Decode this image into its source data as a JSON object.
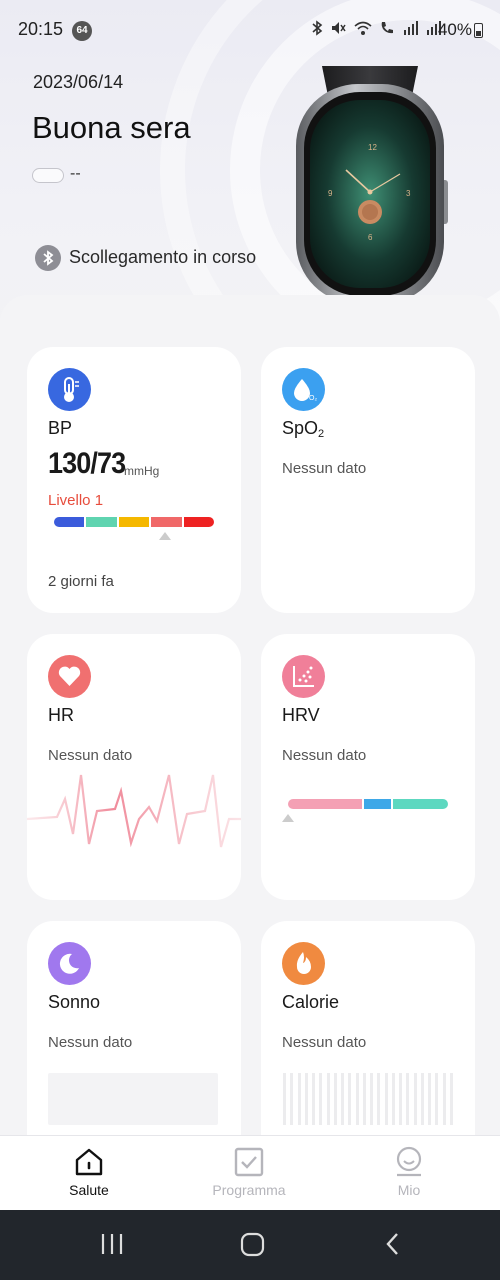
{
  "status_bar": {
    "time": "20:15",
    "notification_count": "64",
    "battery": "40%"
  },
  "header": {
    "date": "2023/06/14",
    "greeting": "Buona sera",
    "device_value": "--",
    "connection_status": "Scollegamento in corso"
  },
  "cards": {
    "bp": {
      "title": "BP",
      "value": "130/73",
      "unit": "mmHg",
      "level": "Livello 1",
      "last_update": "2 giorni fa",
      "scale_colors": [
        "#3b5bdb",
        "#5fd4b0",
        "#f5b800",
        "#f06868",
        "#ee2222"
      ],
      "icon": "thermometer-icon",
      "icon_color": "#3868e0"
    },
    "spo2": {
      "title_main": "SpO",
      "title_sub": "2",
      "status": "Nessun dato",
      "icon": "drop-icon",
      "icon_color": "#3ba0f0"
    },
    "hr": {
      "title": "HR",
      "status": "Nessun dato",
      "icon": "heart-icon",
      "icon_color": "#f07070"
    },
    "hrv": {
      "title": "HRV",
      "status": "Nessun dato",
      "scale_colors": [
        "#f4a0b4",
        "#3ea8e8",
        "#5dd8c0"
      ],
      "icon": "scatter-chart-icon",
      "icon_color": "#f07f99"
    },
    "sleep": {
      "title": "Sonno",
      "status": "Nessun dato",
      "icon": "moon-icon",
      "icon_color": "#a078ee"
    },
    "calories": {
      "title": "Calorie",
      "status": "Nessun dato",
      "icon": "flame-icon",
      "icon_color": "#f08a40"
    }
  },
  "tabs": [
    {
      "label": "Salute",
      "icon": "home-icon",
      "active": true
    },
    {
      "label": "Programma",
      "icon": "checkbox-icon",
      "active": false
    },
    {
      "label": "Mio",
      "icon": "profile-icon",
      "active": false
    }
  ],
  "colors": {
    "tab_active": "#111111",
    "tab_inactive": "#b5b5bb",
    "level_text": "#e74c3c"
  }
}
